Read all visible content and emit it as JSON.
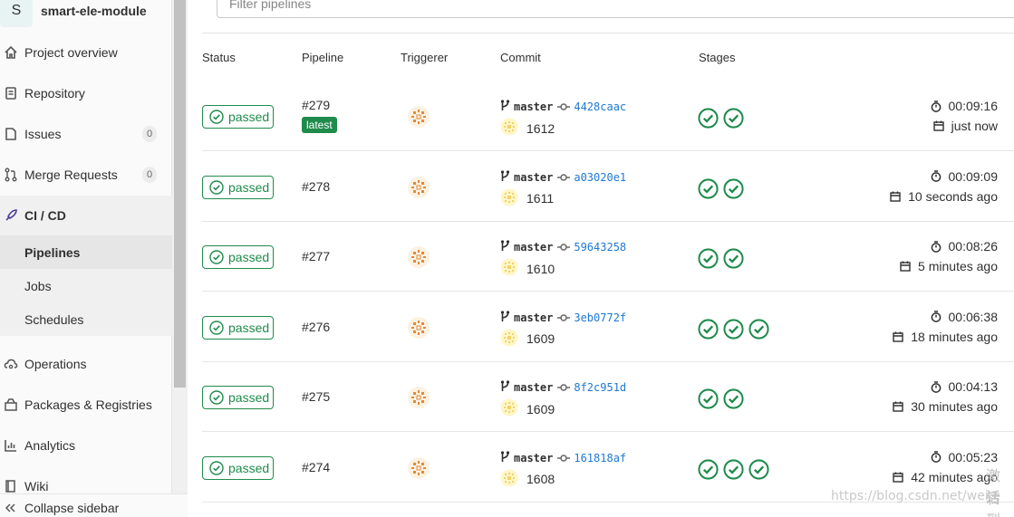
{
  "project": {
    "avatar_letter": "S",
    "name": "smart-ele-module"
  },
  "sidebar": {
    "items": [
      {
        "label": "Project overview",
        "icon": "home-icon"
      },
      {
        "label": "Repository",
        "icon": "doc-icon"
      },
      {
        "label": "Issues",
        "icon": "issues-icon",
        "badge": "0"
      },
      {
        "label": "Merge Requests",
        "icon": "merge-icon",
        "badge": "0"
      },
      {
        "label": "CI / CD",
        "icon": "rocket-icon"
      },
      {
        "label": "Operations",
        "icon": "cloud-icon"
      },
      {
        "label": "Packages & Registries",
        "icon": "package-icon"
      },
      {
        "label": "Analytics",
        "icon": "chart-icon"
      },
      {
        "label": "Wiki",
        "icon": "book-icon"
      }
    ],
    "ci_sub": [
      "Pipelines",
      "Jobs",
      "Schedules"
    ],
    "collapse_label": "Collapse sidebar"
  },
  "filter": {
    "placeholder": "Filter pipelines"
  },
  "table": {
    "headers": [
      "Status",
      "Pipeline",
      "Triggerer",
      "Commit",
      "Stages"
    ],
    "rows": [
      {
        "status": "passed",
        "id": "#279",
        "tag": "latest",
        "branch": "master",
        "sha": "4428caac",
        "msg": "1612",
        "stages": 2,
        "duration": "00:09:16",
        "finished": "just now"
      },
      {
        "status": "passed",
        "id": "#278",
        "tag": "",
        "branch": "master",
        "sha": "a03020e1",
        "msg": "1611",
        "stages": 2,
        "duration": "00:09:09",
        "finished": "10 seconds ago"
      },
      {
        "status": "passed",
        "id": "#277",
        "tag": "",
        "branch": "master",
        "sha": "59643258",
        "msg": "1610",
        "stages": 2,
        "duration": "00:08:26",
        "finished": "5 minutes ago"
      },
      {
        "status": "passed",
        "id": "#276",
        "tag": "",
        "branch": "master",
        "sha": "3eb0772f",
        "msg": "1609",
        "stages": 3,
        "duration": "00:06:38",
        "finished": "18 minutes ago"
      },
      {
        "status": "passed",
        "id": "#275",
        "tag": "",
        "branch": "master",
        "sha": "8f2c951d",
        "msg": "1609",
        "stages": 2,
        "duration": "00:04:13",
        "finished": "30 minutes ago"
      },
      {
        "status": "passed",
        "id": "#274",
        "tag": "",
        "branch": "master",
        "sha": "161818af",
        "msg": "1608",
        "stages": 3,
        "duration": "00:05:23",
        "finished": "42 minutes ago"
      }
    ]
  },
  "watermark": {
    "url": "https://blog.csdn.net/wei",
    "side_top": "激活",
    "side_bottom": "转到"
  },
  "colors": {
    "success": "#1f8b4c",
    "link": "#1f78d1"
  }
}
